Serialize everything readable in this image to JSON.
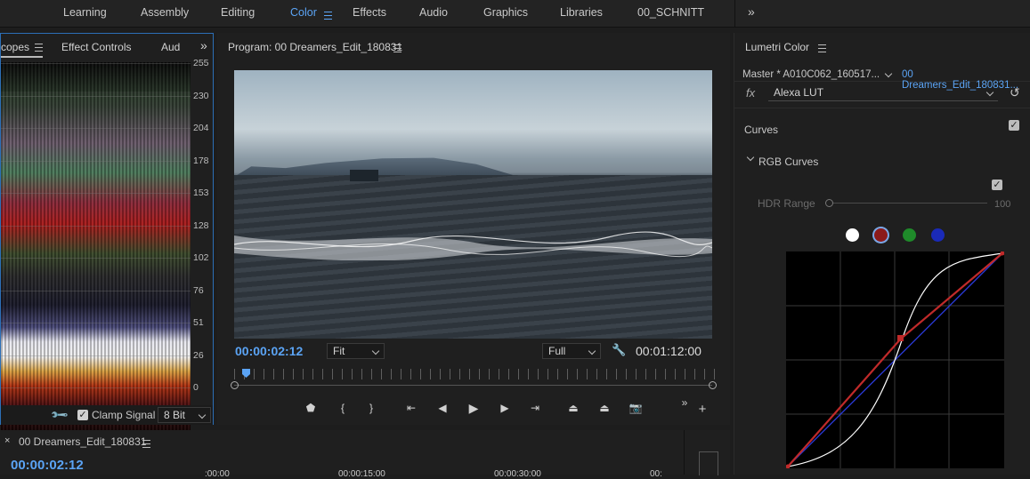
{
  "workspaces": [
    {
      "label": "Learning",
      "active": false
    },
    {
      "label": "Assembly",
      "active": false
    },
    {
      "label": "Editing",
      "active": false
    },
    {
      "label": "Color",
      "active": true
    },
    {
      "label": "Effects",
      "active": false
    },
    {
      "label": "Audio",
      "active": false
    },
    {
      "label": "Graphics",
      "active": false
    },
    {
      "label": "Libraries",
      "active": false
    },
    {
      "label": "00_SCHNITT",
      "active": false
    }
  ],
  "scopes_panel": {
    "tabs": [
      "copes",
      "Effect Controls",
      "Aud"
    ],
    "scale": [
      "255",
      "230",
      "204",
      "178",
      "153",
      "128",
      "102",
      "76",
      "51",
      "26",
      "0"
    ],
    "clamp_label": "Clamp Signal",
    "clamp_checked": true,
    "bit_depth": "8 Bit"
  },
  "program": {
    "title": "Program: 00 Dreamers_Edit_180831",
    "current_time": "00:00:02:12",
    "zoom": "Fit",
    "quality": "Full",
    "duration": "00:01:12:00"
  },
  "lumetri": {
    "title": "Lumetri Color",
    "master_clip": "Master * A010C062_160517...",
    "sequence_clip": "00 Dreamers_Edit_180831...",
    "fx_label": "fx",
    "lut": "Alexa LUT",
    "section": "Curves",
    "subsection": "RGB Curves",
    "hdr_label": "HDR Range",
    "hdr_value": "100",
    "channel_colors": [
      "#ffffff",
      "#8b1a1a",
      "#1f8a2a",
      "#1a2ab8"
    ]
  },
  "timeline": {
    "title": "00 Dreamers_Edit_180831",
    "current_time": "00:00:02:12",
    "ruler": [
      ":00:00",
      "00:00:15:00",
      "00:00:30:00",
      "00:"
    ]
  }
}
